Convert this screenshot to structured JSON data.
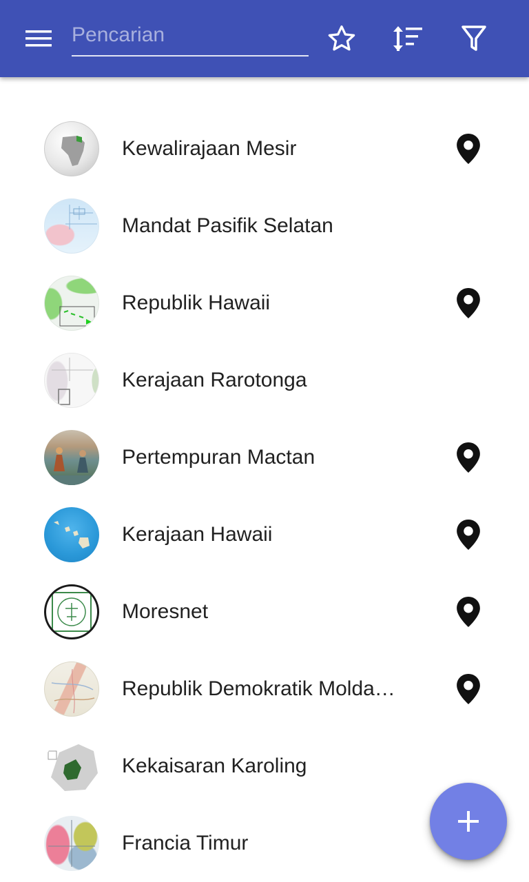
{
  "header": {
    "search_placeholder": "Pencarian",
    "icons": [
      "menu-icon",
      "star-icon",
      "sort-icon",
      "filter-icon"
    ],
    "background_color": "#3f51b5"
  },
  "list": {
    "items": [
      {
        "label": "Kewalirajaan Mesir",
        "has_location": true
      },
      {
        "label": "Mandat Pasifik Selatan",
        "has_location": false
      },
      {
        "label": "Republik Hawaii",
        "has_location": true
      },
      {
        "label": "Kerajaan Rarotonga",
        "has_location": false
      },
      {
        "label": "Pertempuran Mactan",
        "has_location": true
      },
      {
        "label": "Kerajaan Hawaii",
        "has_location": true
      },
      {
        "label": "Moresnet",
        "has_location": true
      },
      {
        "label": "Republik Demokratik Molda…",
        "has_location": true
      },
      {
        "label": "Kekaisaran Karoling",
        "has_location": false
      },
      {
        "label": "Francia Timur",
        "has_location": false
      }
    ]
  },
  "fab": {
    "icon": "plus-icon",
    "color": "#7280e5"
  }
}
